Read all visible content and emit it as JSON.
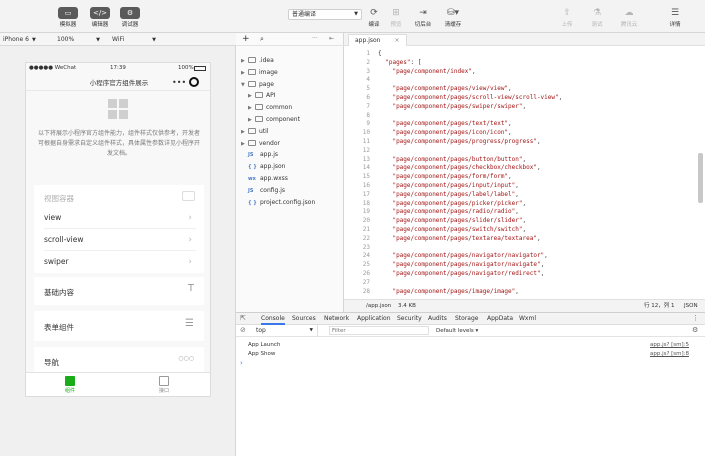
{
  "toolbar": {
    "left_buttons": [
      {
        "label": "模拟器",
        "icon": "simulator-icon"
      },
      {
        "label": "编辑器",
        "icon": "editor-icon"
      },
      {
        "label": "调试器",
        "icon": "debugger-icon"
      }
    ],
    "compile_mode": "普通编译",
    "actions": [
      {
        "label": "编译",
        "icon": "refresh-icon",
        "disabled": false
      },
      {
        "label": "预览",
        "icon": "preview-icon",
        "disabled": true
      },
      {
        "label": "切后台",
        "icon": "background-icon",
        "disabled": false
      },
      {
        "label": "清缓存",
        "icon": "clear-cache-icon",
        "disabled": false
      }
    ],
    "right_actions": [
      {
        "label": "上传",
        "icon": "upload-icon",
        "disabled": true
      },
      {
        "label": "测试",
        "icon": "test-icon",
        "disabled": true
      },
      {
        "label": "腾讯云",
        "icon": "cloud-icon",
        "disabled": true
      },
      {
        "label": "详情",
        "icon": "details-icon",
        "disabled": false
      }
    ]
  },
  "device_bar": {
    "device": "iPhone 6",
    "zoom": "100%",
    "network": "WiFi"
  },
  "phone": {
    "carrier": "●●●●● WeChat",
    "time": "17:39",
    "battery": "100%",
    "nav_title": "小程序官方组件展示",
    "description": "以下将展示小程序官方组件能力，组件样式仅供参考，开发者可根据自身需求自定义组件样式，具体属性参数详见小程序开发文档。",
    "sections": [
      {
        "title": "视图容器",
        "items": [
          "view",
          "scroll-view",
          "swiper"
        ]
      },
      {
        "title": "基础内容"
      },
      {
        "title": "表单组件"
      },
      {
        "title": "导航"
      }
    ],
    "tabs": [
      {
        "label": "组件",
        "active": true
      },
      {
        "label": "接口",
        "active": false
      }
    ]
  },
  "file_tree": [
    {
      "name": ".idea",
      "type": "folder",
      "depth": 0,
      "expanded": false
    },
    {
      "name": "image",
      "type": "folder",
      "depth": 0,
      "expanded": false
    },
    {
      "name": "page",
      "type": "folder",
      "depth": 0,
      "expanded": true
    },
    {
      "name": "API",
      "type": "folder",
      "depth": 1,
      "expanded": false
    },
    {
      "name": "common",
      "type": "folder",
      "depth": 1,
      "expanded": false
    },
    {
      "name": "component",
      "type": "folder",
      "depth": 1,
      "expanded": false
    },
    {
      "name": "util",
      "type": "folder",
      "depth": 0,
      "expanded": false
    },
    {
      "name": "vendor",
      "type": "folder",
      "depth": 0,
      "expanded": false
    },
    {
      "name": "app.js",
      "type": "js",
      "depth": 0
    },
    {
      "name": "app.json",
      "type": "json",
      "depth": 0
    },
    {
      "name": "app.wxss",
      "type": "wxss",
      "depth": 0
    },
    {
      "name": "config.js",
      "type": "js",
      "depth": 0
    },
    {
      "name": "project.config.json",
      "type": "json",
      "depth": 0
    }
  ],
  "editor": {
    "tab": "app.json",
    "lines": [
      "{",
      "  \"pages\": [",
      "    \"page/component/index\",",
      "",
      "    \"page/component/pages/view/view\",",
      "    \"page/component/pages/scroll-view/scroll-view\",",
      "    \"page/component/pages/swiper/swiper\",",
      "",
      "    \"page/component/pages/text/text\",",
      "    \"page/component/pages/icon/icon\",",
      "    \"page/component/pages/progress/progress\",",
      "",
      "    \"page/component/pages/button/button\",",
      "    \"page/component/pages/checkbox/checkbox\",",
      "    \"page/component/pages/form/form\",",
      "    \"page/component/pages/input/input\",",
      "    \"page/component/pages/label/label\",",
      "    \"page/component/pages/picker/picker\",",
      "    \"page/component/pages/radio/radio\",",
      "    \"page/component/pages/slider/slider\",",
      "    \"page/component/pages/switch/switch\",",
      "    \"page/component/pages/textarea/textarea\",",
      "",
      "    \"page/component/pages/navigator/navigator\",",
      "    \"page/component/pages/navigator/navigate\",",
      "    \"page/component/pages/navigator/redirect\",",
      "",
      "    \"page/component/pages/image/image\","
    ],
    "status_path": "/app.json",
    "status_size": "3.4 KB",
    "status_pos": "行 12，列 1",
    "status_lang": "JSON"
  },
  "devtools": {
    "tabs": [
      "Console",
      "Sources",
      "Network",
      "Application",
      "Security",
      "Audits",
      "Storage",
      "AppData",
      "Wxml"
    ],
    "active_tab": "Console",
    "context": "top",
    "filter_placeholder": "Filter",
    "levels": "Default levels ▾",
    "logs": [
      {
        "text": "App Launch",
        "source": "app.js? [sm]:5"
      },
      {
        "text": "App Show",
        "source": "app.js? [sm]:8"
      }
    ],
    "prompt": "›"
  },
  "colors": {
    "accent": "#3b78e7",
    "tab_active": "#1aad19"
  }
}
